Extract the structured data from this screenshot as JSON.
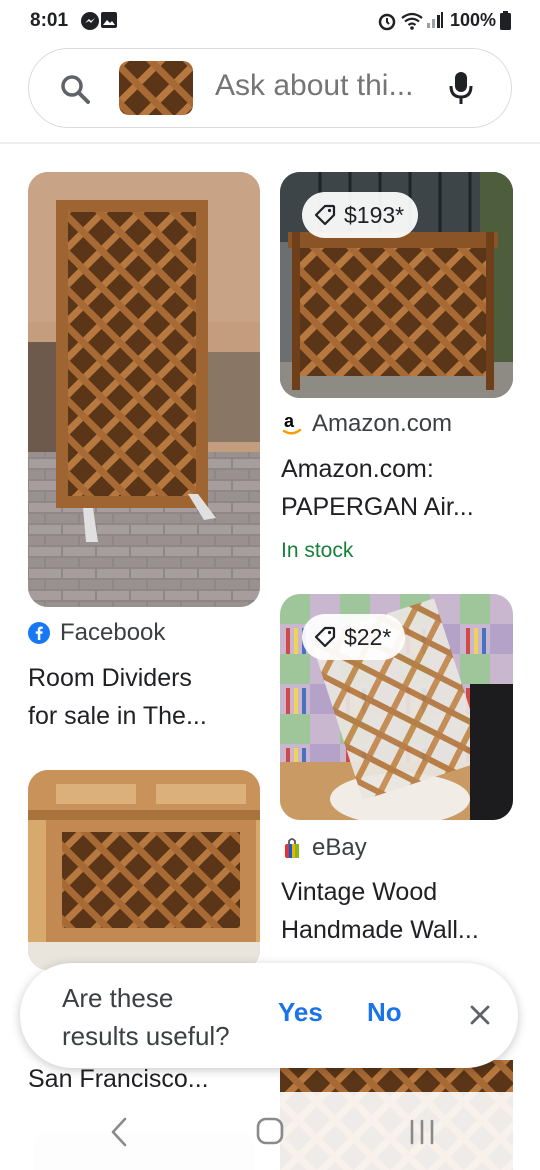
{
  "status": {
    "time": "8:01",
    "battery": "100%",
    "icons": [
      "messenger-icon",
      "gallery-icon",
      "alarm-icon",
      "wifi-icon",
      "signal-icon",
      "battery-icon"
    ]
  },
  "search": {
    "placeholder": "Ask about thi..."
  },
  "results": [
    {
      "source": "Facebook",
      "title_lines": [
        "Room Dividers",
        "for sale in The..."
      ]
    },
    {
      "price": "$193*",
      "source": "Amazon.com",
      "title_lines": [
        "Amazon.com:",
        "PAPERGAN Air..."
      ],
      "stock": "In stock"
    },
    {
      "price": "$22*",
      "source": "eBay",
      "title_lines": [
        "Vintage Wood",
        "Handmade Wall..."
      ]
    },
    {
      "title_lines": [
        "San Francisco..."
      ]
    }
  ],
  "feedback": {
    "question_lines": [
      "Are these",
      "results useful?"
    ],
    "yes": "Yes",
    "no": "No"
  },
  "colors": {
    "link_blue": "#1a73e8",
    "stock_green": "#188038",
    "facebook_blue": "#1877f2"
  }
}
